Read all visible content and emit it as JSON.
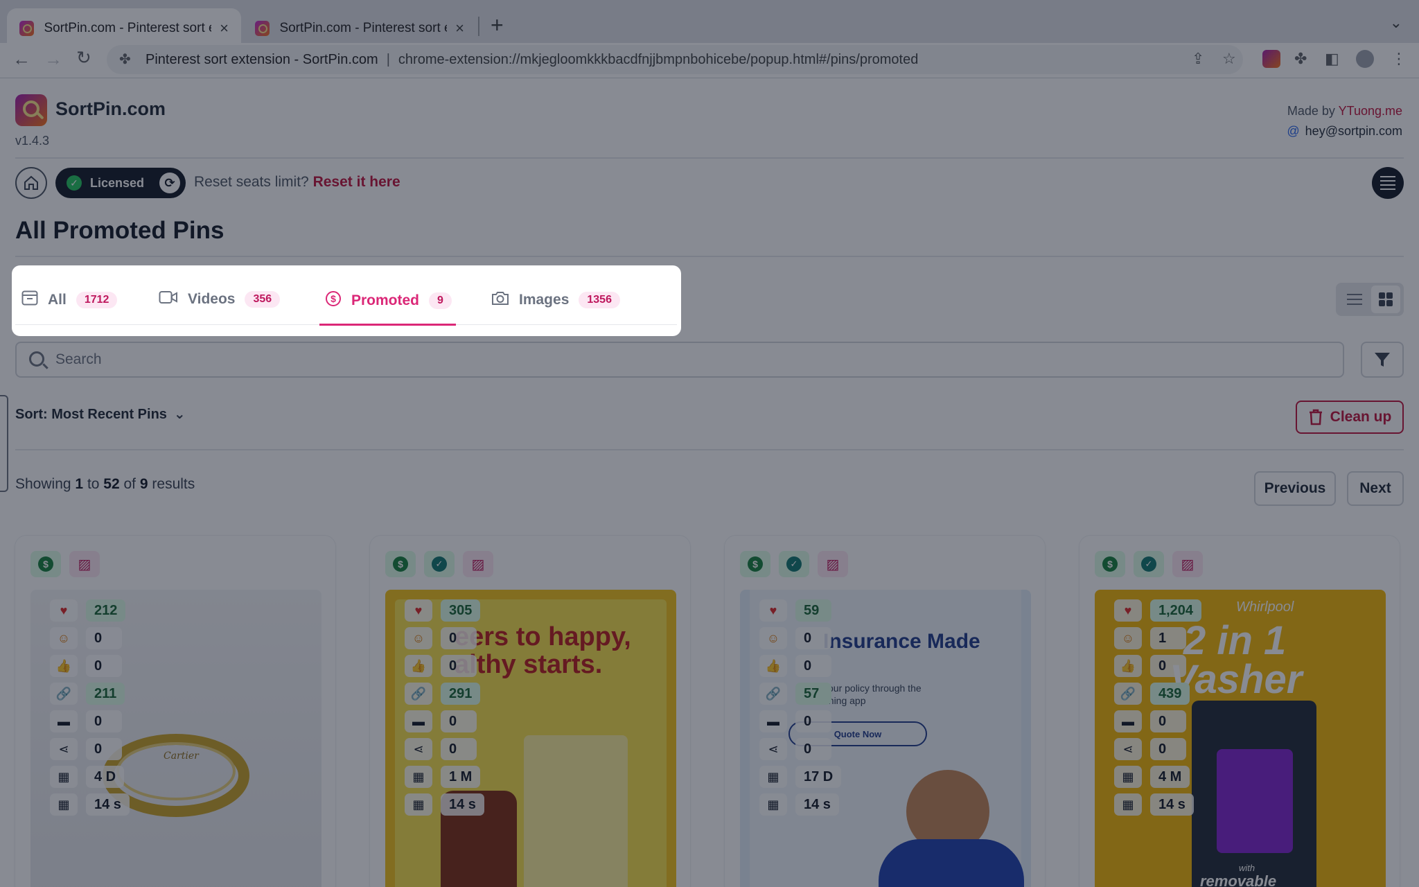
{
  "browser": {
    "tabs": [
      {
        "title": "SortPin.com - Pinterest sort extension - SortPin.com",
        "active": true
      },
      {
        "title": "SortPin.com - Pinterest sort extension - SortPin.com",
        "active": false
      }
    ],
    "omnibox": {
      "site_name": "Pinterest sort extension - SortPin.com",
      "url": "chrome-extension://mkjegloomkkkbacdfnjjbmpnbohicebe/popup.html#/pins/promoted"
    }
  },
  "app": {
    "brand": "SortPin.com",
    "version": "v1.4.3",
    "made_by_prefix": "Made by",
    "made_by_link": "YTuong.me",
    "email": "hey@sortpin.com",
    "license_label": "Licensed",
    "reset_prompt": "Reset seats limit?",
    "reset_link": "Reset it here",
    "page_title": "All Promoted Pins",
    "accent_color": "#db2777"
  },
  "filter_tabs": [
    {
      "label": "All",
      "count": "1712",
      "icon": "inbox-icon"
    },
    {
      "label": "Videos",
      "count": "356",
      "icon": "video-icon"
    },
    {
      "label": "Promoted",
      "count": "9",
      "icon": "dollar-circle-icon",
      "active": true
    },
    {
      "label": "Images",
      "count": "1356",
      "icon": "camera-icon"
    }
  ],
  "search": {
    "placeholder": "Search"
  },
  "sort": {
    "label": "Sort: Most Recent Pins"
  },
  "cleanup_label": "Clean up",
  "results": {
    "prefix": "Showing",
    "from": "1",
    "to_word": "to",
    "to": "52",
    "of_word": "of",
    "total": "9",
    "suffix": "results"
  },
  "pagination": {
    "previous": "Previous",
    "next": "Next"
  },
  "cards": [
    {
      "verified": false,
      "likes": "212",
      "reactions": "0",
      "thumbs": "0",
      "saves": "211",
      "comments": "0",
      "shares": "0",
      "age": "4 D",
      "updated": "14 s",
      "image_text": "Cartier"
    },
    {
      "verified": true,
      "likes": "305",
      "reactions": "0",
      "thumbs": "0",
      "saves": "291",
      "comments": "0",
      "shares": "0",
      "age": "1 M",
      "updated": "14 s",
      "image_text": "eers to happy,\nalthy starts."
    },
    {
      "verified": true,
      "likes": "59",
      "reactions": "0",
      "thumbs": "0",
      "saves": "57",
      "comments": "0",
      "shares": "0",
      "age": "17 D",
      "updated": "14 s",
      "image_text": "Insurance Made",
      "image_text2": "your policy through the",
      "image_text3": "nning app",
      "image_cta": "Quote Now"
    },
    {
      "verified": true,
      "likes": "1,204",
      "reactions": "1",
      "thumbs": "0",
      "saves": "439",
      "comments": "0",
      "shares": "0",
      "age": "4 M",
      "updated": "14 s",
      "image_text": "Whirlpool",
      "image_text2": "2 in 1",
      "image_text3": "Vasher",
      "image_text4": "with",
      "image_text5": "removable"
    }
  ]
}
